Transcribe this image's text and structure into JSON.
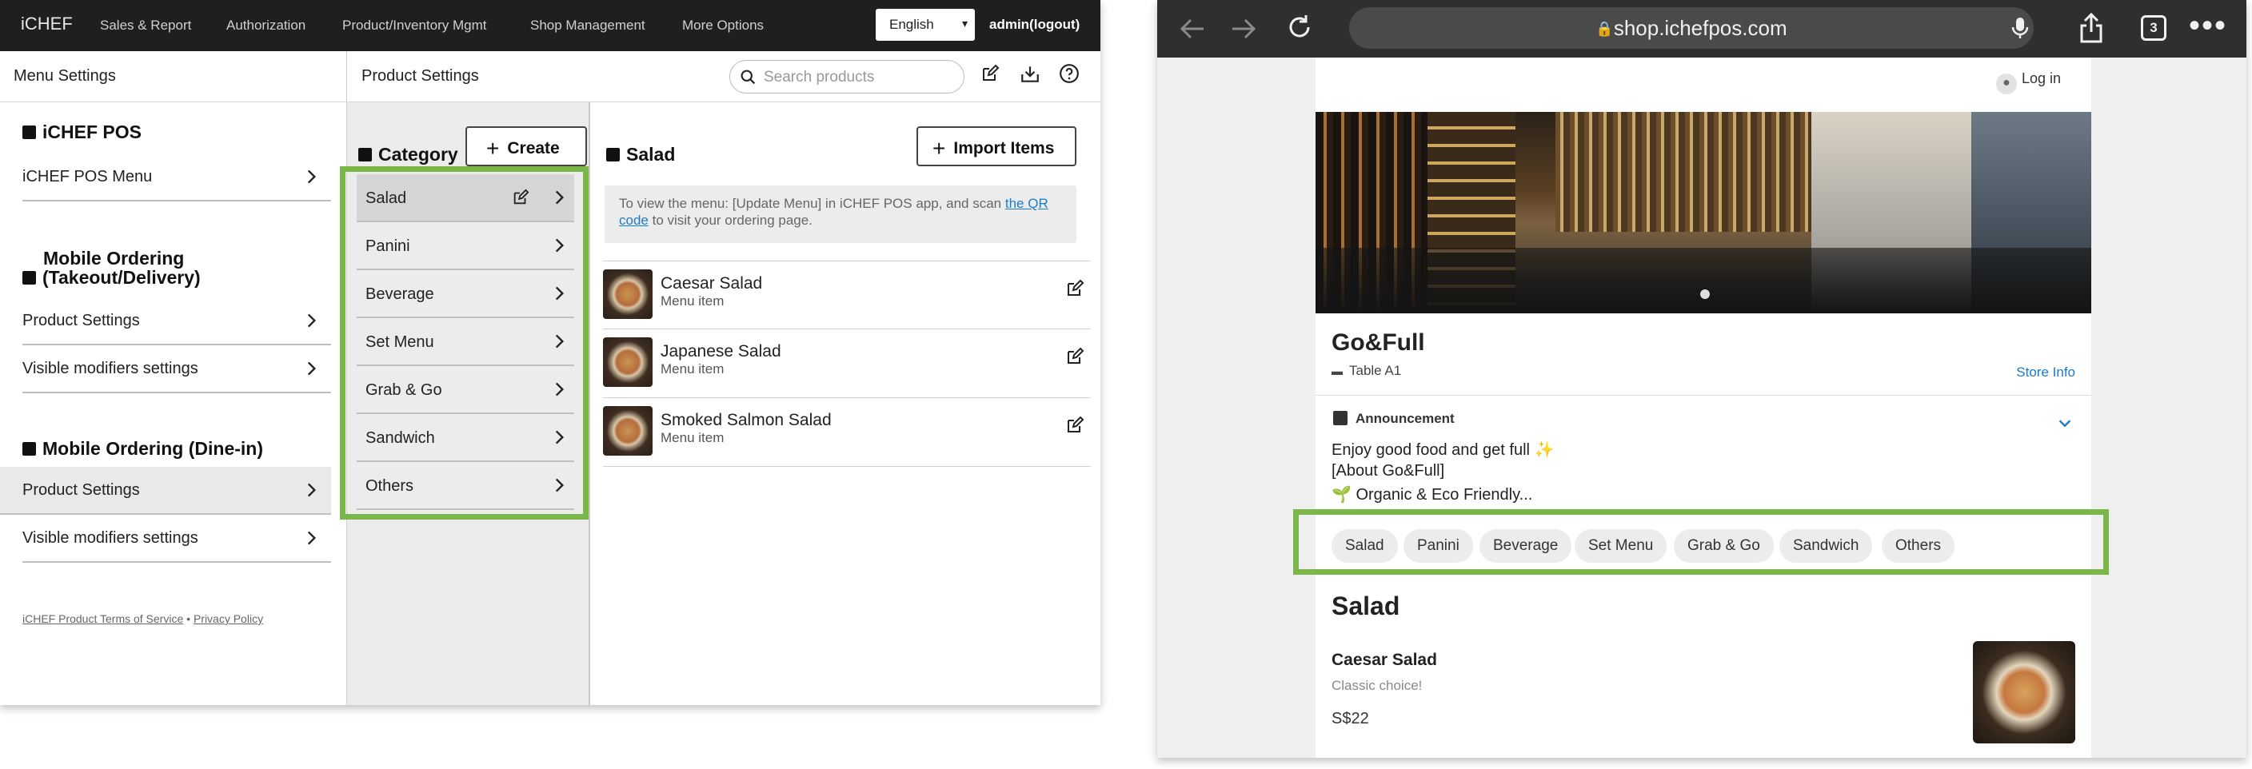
{
  "admin": {
    "brand": "iCHEF",
    "nav": [
      "Sales & Report",
      "Authorization",
      "Product/Inventory Mgmt",
      "Shop Management",
      "More Options"
    ],
    "language": "English",
    "user": "admin(logout)",
    "menu_settings_title": "Menu Settings",
    "product_settings_title": "Product Settings",
    "search_placeholder": "Search products",
    "sections": {
      "pos_title": "iCHEF POS",
      "pos_menu": "iCHEF POS Menu",
      "mo_title_line1": "Mobile Ordering",
      "mo_title_line2": "(Takeout/Delivery)",
      "mo_product_settings": "Product Settings",
      "mo_visible_modifiers": "Visible modifiers settings",
      "dine_title": "Mobile Ordering (Dine-in)",
      "dine_product_settings": "Product Settings",
      "dine_visible_modifiers": "Visible modifiers settings"
    },
    "footer": {
      "terms": "iCHEF Product Terms of Service",
      "sep": " • ",
      "privacy": "Privacy Policy"
    },
    "category_title": "Category",
    "create_label": "Create",
    "categories": [
      "Salad",
      "Panini",
      "Beverage",
      "Set Menu",
      "Grab & Go",
      "Sandwich",
      "Others"
    ],
    "items_title": "Salad",
    "import_label": "Import Items",
    "info_text": "To view the menu: [Update Menu] in iCHEF POS app, and scan ",
    "info_link": "the QR code",
    "info_text2": " to visit your ordering page.",
    "items": [
      {
        "name": "Caesar Salad",
        "type": "Menu item"
      },
      {
        "name": "Japanese Salad",
        "type": "Menu item"
      },
      {
        "name": "Smoked Salmon Salad",
        "type": "Menu item"
      }
    ]
  },
  "browser": {
    "url": "shop.ichefpos.com",
    "tab_count": "3",
    "login": "Log in",
    "store_name": "Go&Full",
    "table": "Table A1",
    "store_info": "Store Info",
    "announcement_title": "Announcement",
    "announcement_lines": [
      "Enjoy good food and get full ✨",
      "[About Go&Full]",
      "🌱 Organic & Eco Friendly..."
    ],
    "chips": [
      "Salad",
      "Panini",
      "Beverage",
      "Set Menu",
      "Grab & Go",
      "Sandwich",
      "Others"
    ],
    "section_title": "Salad",
    "product": {
      "name": "Caesar Salad",
      "desc": "Classic choice!",
      "price": "S$22"
    }
  },
  "colors": {
    "highlight": "#7ab648",
    "link": "#1a7cc7",
    "topbar": "#1f1f1f"
  }
}
